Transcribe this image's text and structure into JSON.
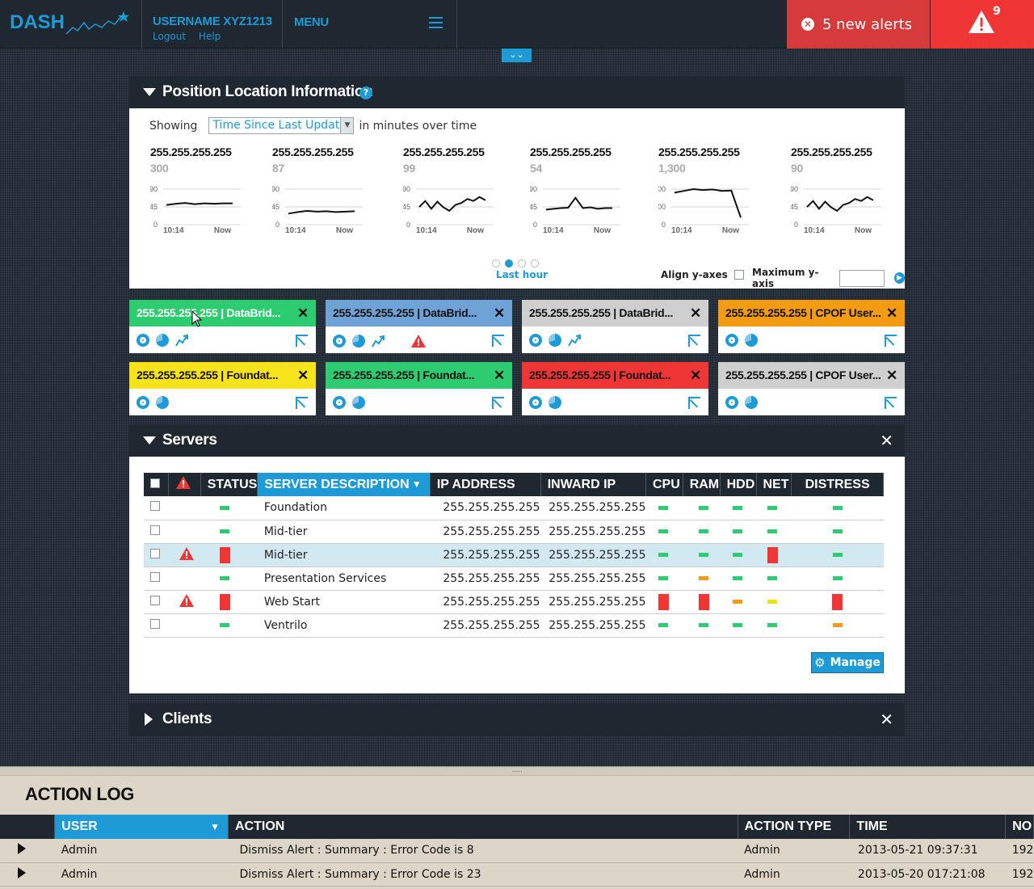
{
  "header": {
    "logo": "DASH",
    "username": "USERNAME XYZ1213",
    "logout": "Logout",
    "help": "Help",
    "menu": "MENU",
    "alerts_label": "5 new alerts",
    "warning_count": "9"
  },
  "position_panel": {
    "title": "Position Location Information",
    "showing_label": "Showing",
    "select_value": "Time Since Last Update",
    "suffix": "in minutes over time",
    "last_hour": "Last hour",
    "align_label": "Align y-axes",
    "max_y_label": "Maximum y-axis",
    "sparks": [
      {
        "ip": "255.255.255.255",
        "value": "300",
        "ticks": [
          "90",
          "45",
          "0"
        ],
        "x_start": "10:14",
        "x_end": "Now",
        "ymax": 90,
        "points": [
          50,
          53,
          55,
          52,
          54,
          53,
          54,
          54
        ]
      },
      {
        "ip": "255.255.255.255",
        "value": "87",
        "ticks": [
          "90",
          "45",
          "0"
        ],
        "x_start": "10:14",
        "x_end": "Now",
        "ymax": 90,
        "points": [
          28,
          32,
          35,
          33,
          34,
          32,
          33,
          34
        ]
      },
      {
        "ip": "255.255.255.255",
        "value": "99",
        "ticks": [
          "90",
          "45",
          "0"
        ],
        "x_start": "10:14",
        "x_end": "Now",
        "ymax": 90,
        "points": [
          45,
          60,
          40,
          58,
          44,
          35,
          50,
          55,
          65,
          60,
          70,
          62
        ]
      },
      {
        "ip": "255.255.255.255",
        "value": "54",
        "ticks": [
          "90",
          "45",
          "0"
        ],
        "x_start": "10:14",
        "x_end": "Now",
        "ymax": 90,
        "points": [
          38,
          40,
          42,
          43,
          68,
          42,
          44,
          40,
          42,
          42
        ]
      },
      {
        "ip": "255.255.255.255",
        "value": "1,300",
        "ticks": [
          "200",
          "100",
          "0"
        ],
        "x_start": "10:14",
        "x_end": "Now",
        "ymax": 200,
        "points": [
          180,
          190,
          200,
          195,
          198,
          190,
          192,
          40
        ]
      },
      {
        "ip": "255.255.255.255",
        "value": "90",
        "ticks": [
          "90",
          "45",
          "0"
        ],
        "x_start": "10:14",
        "x_end": "Now",
        "ymax": 90,
        "points": [
          45,
          60,
          40,
          58,
          44,
          35,
          50,
          55,
          65,
          60,
          70,
          62
        ]
      }
    ]
  },
  "tiles": [
    {
      "label": "255.255.255.255 | DataBrid...",
      "color": "#2ecc71",
      "text_color": "#ffffff",
      "icons": [
        "gear",
        "pie",
        "trend"
      ]
    },
    {
      "label": "255.255.255.255 | DataBrid...",
      "color": "#6fa3d8",
      "text_color": "#111111",
      "icons": [
        "gear",
        "pie",
        "trend",
        "warn"
      ]
    },
    {
      "label": "255.255.255.255 | DataBrid...",
      "color": "#cfcfcf",
      "text_color": "#111111",
      "icons": [
        "gear",
        "pie",
        "trend"
      ]
    },
    {
      "label": "255.255.255.255 | CPOF User...",
      "color": "#f39c12",
      "text_color": "#111111",
      "icons": [
        "gear",
        "pie"
      ]
    },
    {
      "label": "255.255.255.255 | Foundat...",
      "color": "#f7e31a",
      "text_color": "#111111",
      "icons": [
        "gear",
        "pie"
      ]
    },
    {
      "label": "255.255.255.255 | Foundat...",
      "color": "#2ecc71",
      "text_color": "#111111",
      "icons": [
        "gear",
        "pie"
      ]
    },
    {
      "label": "255.255.255.255 | Foundat...",
      "color": "#f03535",
      "text_color": "#111111",
      "icons": [
        "gear",
        "pie"
      ]
    },
    {
      "label": "255.255.255.255 | CPOF User...",
      "color": "#cfcfcf",
      "text_color": "#111111",
      "icons": [
        "gear",
        "pie"
      ]
    }
  ],
  "servers_panel": {
    "title": "Servers",
    "columns": [
      "STATUS",
      "SERVER DESCRIPTION",
      "IP ADDRESS",
      "INWARD IP",
      "CPU",
      "RAM",
      "HDD",
      "NET",
      "DISTRESS"
    ],
    "manage": "Manage",
    "rows": [
      {
        "alert": false,
        "status": "green",
        "desc": "Foundation",
        "ip": "255.255.255.255",
        "inward": "255.255.255.255",
        "cpu": "green",
        "ram": "green",
        "hdd": "green",
        "net": "green",
        "distress": "green"
      },
      {
        "alert": false,
        "status": "green",
        "desc": "Mid-tier",
        "ip": "255.255.255.255",
        "inward": "255.255.255.255",
        "cpu": "green",
        "ram": "green",
        "hdd": "green",
        "net": "green",
        "distress": "green"
      },
      {
        "alert": true,
        "status": "red",
        "desc": "Mid-tier",
        "ip": "255.255.255.255",
        "inward": "255.255.255.255",
        "cpu": "green",
        "ram": "green",
        "hdd": "green",
        "net": "red",
        "distress": "green",
        "highlight": true
      },
      {
        "alert": false,
        "status": "green",
        "desc": "Presentation Services",
        "ip": "255.255.255.255",
        "inward": "255.255.255.255",
        "cpu": "green",
        "ram": "orange",
        "hdd": "green",
        "net": "green",
        "distress": "green"
      },
      {
        "alert": true,
        "status": "red",
        "desc": "Web Start",
        "ip": "255.255.255.255",
        "inward": "255.255.255.255",
        "cpu": "red",
        "ram": "red",
        "hdd": "orange",
        "net": "yellow",
        "distress": "red"
      },
      {
        "alert": false,
        "status": "green",
        "desc": "Ventrilo",
        "ip": "255.255.255.255",
        "inward": "255.255.255.255",
        "cpu": "green",
        "ram": "green",
        "hdd": "green",
        "net": "green",
        "distress": "orange"
      }
    ]
  },
  "clients_panel": {
    "title": "Clients"
  },
  "action_log": {
    "title": "ACTION LOG",
    "columns": [
      "USER",
      "ACTION",
      "ACTION TYPE",
      "TIME",
      "NO"
    ],
    "rows": [
      {
        "user": "Admin",
        "action": "Dismiss Alert : Summary : Error Code is 8",
        "type": "Admin",
        "time": "2013-05-21 09:37:31",
        "no": "192"
      },
      {
        "user": "Admin",
        "action": "Dismiss Alert : Summary : Error Code is 23",
        "type": "Admin",
        "time": "2013-05-20 017:21:08",
        "no": "192"
      }
    ]
  }
}
